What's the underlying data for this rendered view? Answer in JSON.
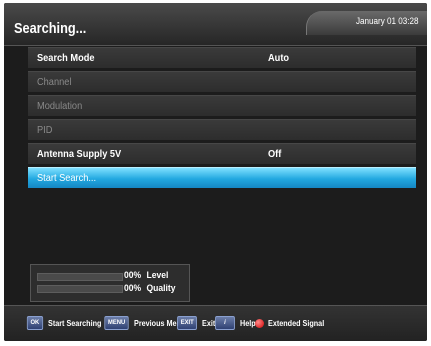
{
  "header": {
    "title": "Searching...",
    "datetime": "January 01 03:28"
  },
  "menu": {
    "rows": [
      {
        "label": "Search Mode",
        "value": "Auto"
      },
      {
        "label": "Channel",
        "value": ""
      },
      {
        "label": "Modulation",
        "value": ""
      },
      {
        "label": "PID",
        "value": ""
      },
      {
        "label": "Antenna Supply 5V",
        "value": "Off"
      },
      {
        "label": "Start Search...",
        "value": ""
      }
    ]
  },
  "signal": {
    "level_percent": "00%",
    "level_label": "Level",
    "level_fraction": 0,
    "quality_percent": "00%",
    "quality_label": "Quality",
    "quality_fraction": 0
  },
  "footer": {
    "hints": [
      {
        "key": "OK",
        "text": "Start Searching"
      },
      {
        "key": "MENU",
        "text": "Previous Menu"
      },
      {
        "key": "EXIT",
        "text": "Exit"
      },
      {
        "key": "i",
        "text": "Help"
      },
      {
        "key": "red-button",
        "text": "Extended Signal"
      }
    ]
  },
  "colors": {
    "highlight": "#22a8e0",
    "background": "#1c1c1c",
    "red_button": "#d10000"
  }
}
